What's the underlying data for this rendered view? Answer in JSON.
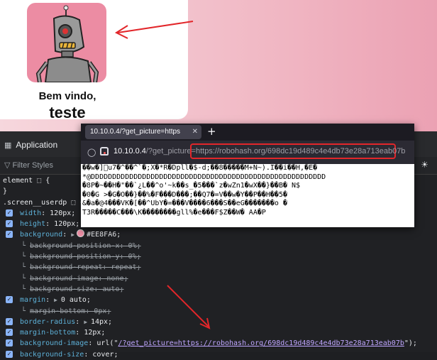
{
  "profile": {
    "welcome": "Bem vindo,",
    "username": "teste",
    "avatar_alt": "robot avatar"
  },
  "devtools": {
    "app_label": "Application",
    "filter_placeholder": "Filter Styles",
    "lines": [
      {
        "kind": "plain",
        "text": "element ⬚ {"
      },
      {
        "kind": "plain",
        "text": "}"
      },
      {
        "kind": "plain",
        "text": ".screen__userdp ⬚ {"
      },
      {
        "kind": "prop",
        "prop": "width",
        "value": "120px;"
      },
      {
        "kind": "prop",
        "prop": "height",
        "value": "120px;"
      },
      {
        "kind": "prop-swatch",
        "prop": "background",
        "value": "#EE8FA6;"
      },
      {
        "kind": "sub",
        "text": "background-position-x: 0%;"
      },
      {
        "kind": "sub",
        "text": "background-position-y: 0%;"
      },
      {
        "kind": "sub",
        "text": "background-repeat: repeat;"
      },
      {
        "kind": "sub",
        "text": "background-image: none;"
      },
      {
        "kind": "sub",
        "text": "background-size: auto;"
      },
      {
        "kind": "prop-tri",
        "prop": "margin",
        "value": "0 auto;"
      },
      {
        "kind": "sub",
        "text": "margin-bottom: 0px;"
      },
      {
        "kind": "prop-tri",
        "prop": "border-radius",
        "value": "14px;"
      },
      {
        "kind": "prop",
        "prop": "margin-bottom",
        "value": "12px;"
      },
      {
        "kind": "prop-link",
        "prop": "background-image",
        "prefix": "url(\"",
        "link": "/?get_picture=https://robohash.org/698dc19d489c4e4db73e28a713eab07b",
        "suffix": "\");"
      },
      {
        "kind": "prop",
        "prop": "background-size",
        "value": "cover;"
      }
    ]
  },
  "popup": {
    "tab_title": "10.10.0.4/?get_picture=https",
    "new_tab": "+",
    "url_host": "10.10.0.4",
    "url_path_prefix": "/?get_picture=",
    "url_highlight": "https://robohash.org/698dc19d489c4e4db73e28a713eab07b",
    "garbled": [
      "��w�]\u0000u7�^��^`�;X�*R�Dpll�$-d;��8�����M+N~).I��i��H,�E�",
      "*@DDDDDDDDDDDDDDDDDDDDDDDDDDDDDDDDDDDDDDDDDDDDDDDDDDDDDDD",
      "�8P�~��H�\"��`¿L��^o'~k��s_�5���`z�wZn1�wX��}��B� N$",
      "�0�G >�G�O��}��%�F���D���;��Q7�=V��w�Y��P��H��5�",
      "&�a�@4���VK�[��^UbY�=���V����6���S��eG�������o �",
      "T3R�����C���\\K��������gll%�e���F$Z��W� AA�P"
    ]
  },
  "colors": {
    "avatar_bg": "#EE8FA6",
    "annotation_red": "#e2262a"
  }
}
